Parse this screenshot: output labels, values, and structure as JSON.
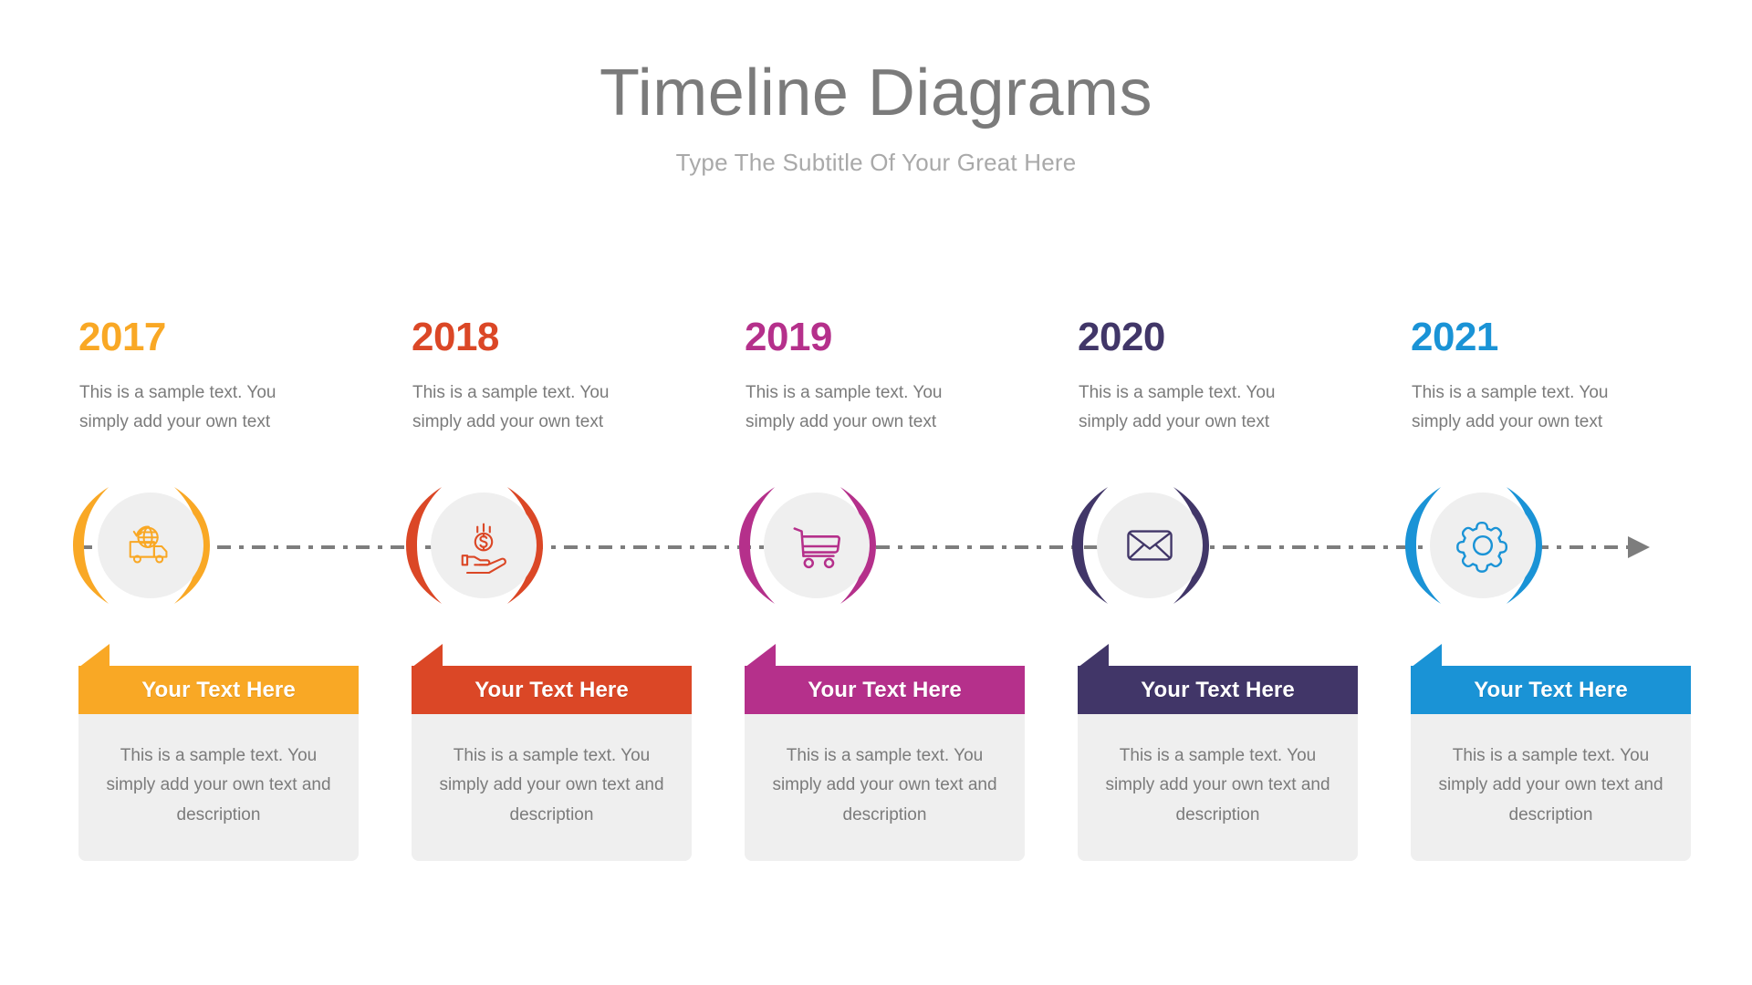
{
  "header": {
    "title": "Timeline Diagrams",
    "subtitle": "Type The Subtitle Of Your Great Here",
    "title_color": "#7b7b7b",
    "subtitle_color": "#a9a9a9"
  },
  "timeline": {
    "axis_color": "#7d7d7d",
    "axis_style": "dash-dot",
    "arrow_direction": "right",
    "circle_bg": "#efefef"
  },
  "milestones": [
    {
      "year": "2017",
      "color": "#f9a825",
      "description": "This is a sample text. You simply add your own text",
      "icon": "delivery-truck-globe-icon",
      "card": {
        "heading": "Your Text Here",
        "body": "This is a sample text. You simply add your own text and description"
      }
    },
    {
      "year": "2018",
      "color": "#db4726",
      "description": "This is a sample text. You simply add your own text",
      "icon": "hand-holding-dollar-coin-icon",
      "card": {
        "heading": "Your Text Here",
        "body": "This is a sample text. You simply add your own text and description"
      }
    },
    {
      "year": "2019",
      "color": "#b5308b",
      "description": "This is a sample text. You simply add your own text",
      "icon": "shopping-cart-icon",
      "card": {
        "heading": "Your Text Here",
        "body": "This is a sample text. You simply add your own text and description"
      }
    },
    {
      "year": "2020",
      "color": "#413668",
      "description": "This is a sample text. You simply add your own text",
      "icon": "envelope-icon",
      "card": {
        "heading": "Your Text Here",
        "body": "This is a sample text. You simply add your own text and description"
      }
    },
    {
      "year": "2021",
      "color": "#1a93d6",
      "description": "This is a sample text. You simply add your own text",
      "icon": "gear-icon",
      "card": {
        "heading": "Your Text Here",
        "body": "This is a sample text. You simply add your own text and description"
      }
    }
  ]
}
